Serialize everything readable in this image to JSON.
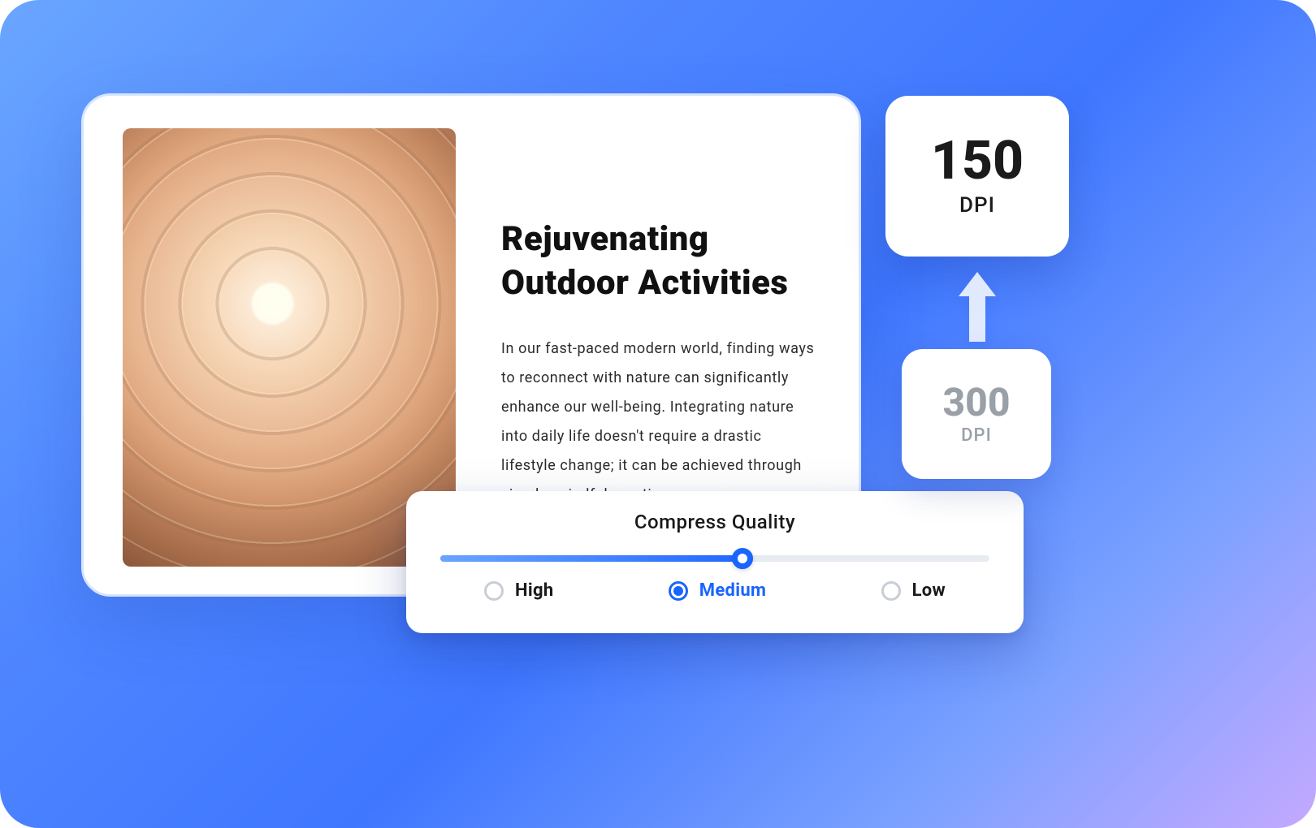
{
  "document": {
    "title": "Rejuvenating Outdoor Activities",
    "body": "In our fast-paced modern world, finding ways to reconnect with nature can significantly enhance our well-being. Integrating nature into daily life doesn't require a drastic lifestyle change; it can be achieved through simple, mindful practices.",
    "image_alt": "spiral-staircase"
  },
  "quality": {
    "title": "Compress  Quality",
    "slider_percent": 55,
    "options": [
      {
        "id": "high",
        "label": "High",
        "selected": false
      },
      {
        "id": "medium",
        "label": "Medium",
        "selected": true
      },
      {
        "id": "low",
        "label": "Low",
        "selected": false
      }
    ]
  },
  "dpi": {
    "target": {
      "value": "150",
      "unit": "DPI"
    },
    "source": {
      "value": "300",
      "unit": "DPI"
    }
  }
}
